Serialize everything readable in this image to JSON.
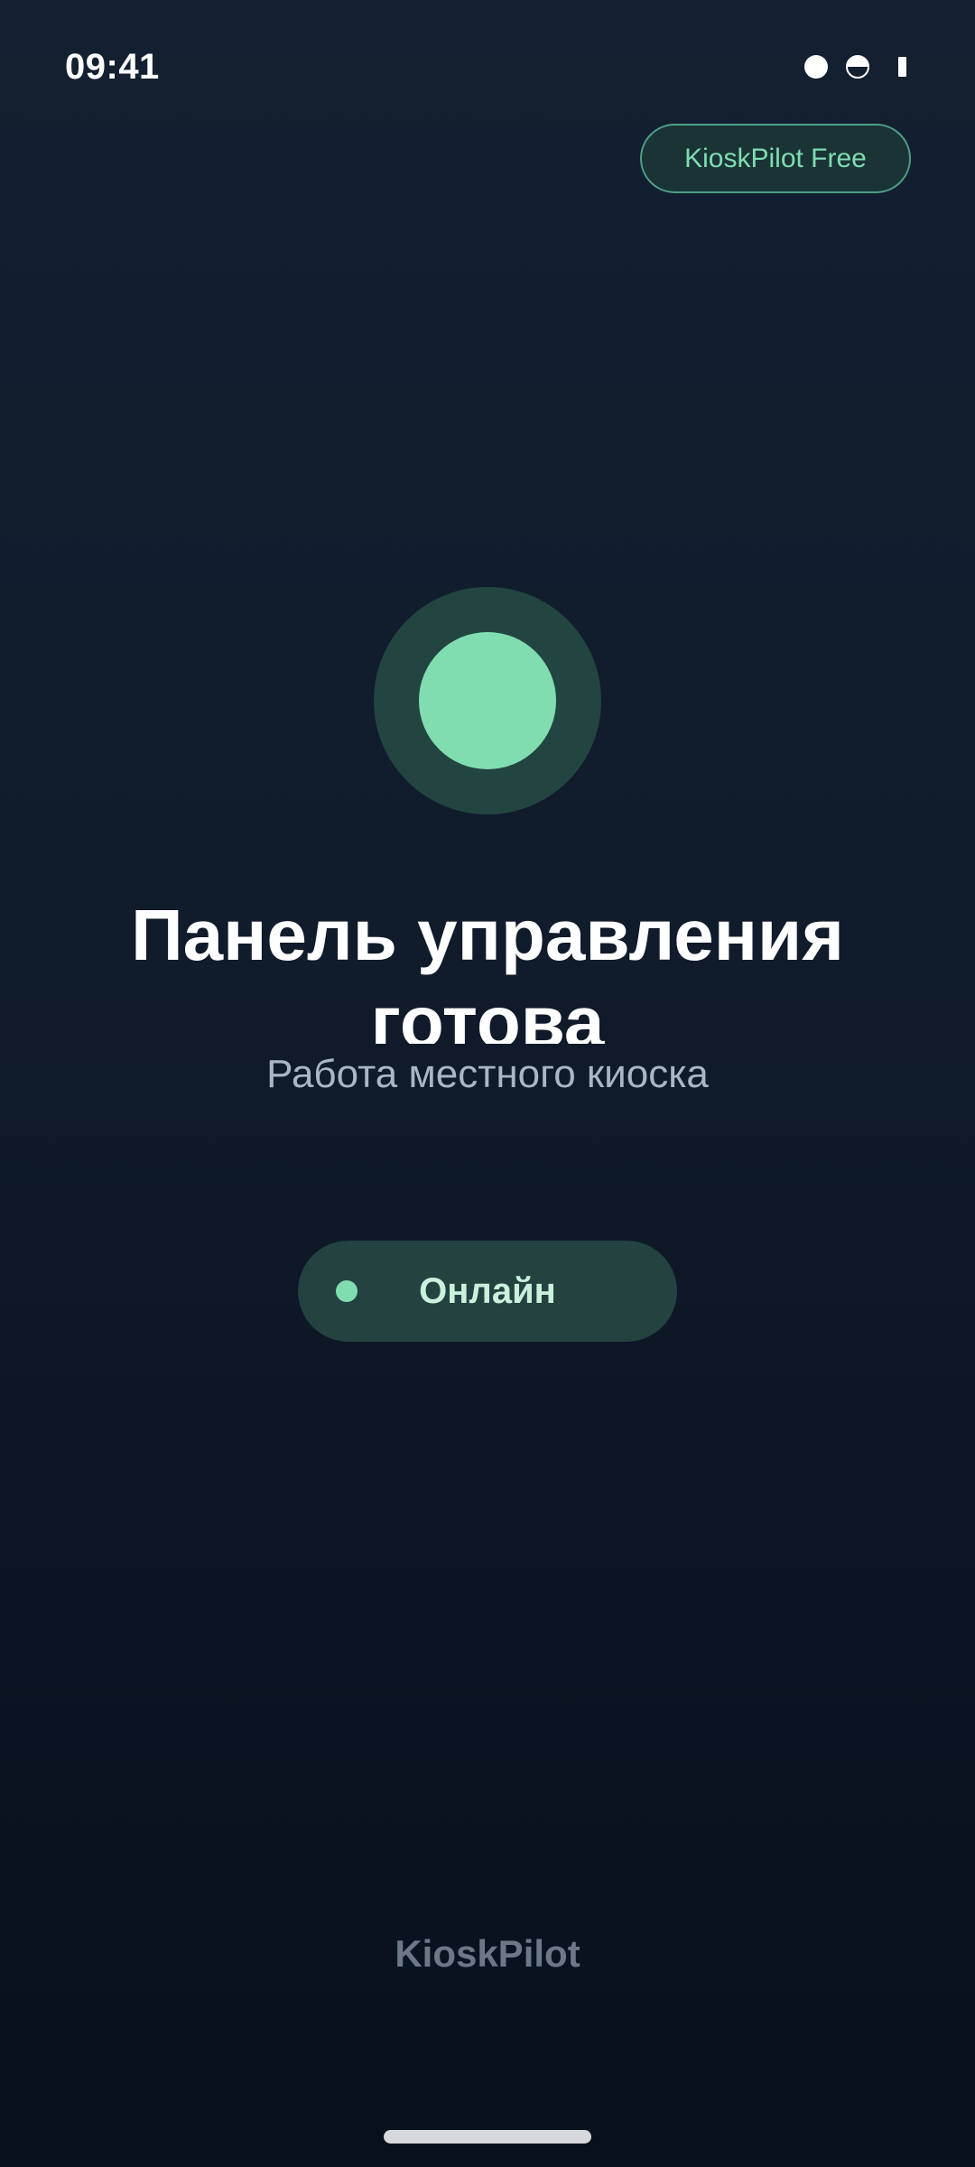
{
  "status_bar": {
    "time": "09:41",
    "icons": [
      "signal-dot-icon",
      "half-circle-icon",
      "battery-icon"
    ]
  },
  "plan_badge": {
    "label": "KioskPilot Free"
  },
  "indicator": {
    "icon": "status-circle-icon",
    "accent_color": "#80ddb0"
  },
  "main": {
    "title": "Панель управления готова",
    "subtitle": "Работа местного киоска"
  },
  "status_pill": {
    "label": "Онлайн",
    "dot_color": "#80ddb0"
  },
  "footer": {
    "brand": "KioskPilot"
  }
}
